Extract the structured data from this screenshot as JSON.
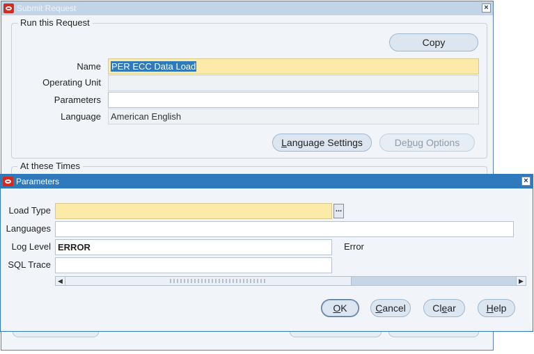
{
  "submit_window": {
    "title": "Submit Request",
    "run_group": {
      "legend": "Run this Request",
      "copy_button": "Copy",
      "name_label": "Name",
      "name_value": "PER ECC Data Load",
      "operating_unit_label": "Operating Unit",
      "operating_unit_value": "",
      "parameters_label": "Parameters",
      "parameters_value": "",
      "language_label": "Language",
      "language_value": "American English",
      "language_settings_button": {
        "pre": "",
        "ul": "L",
        "post": "anguage Settings"
      },
      "debug_options_button": {
        "pre": "De",
        "ul": "b",
        "post": "ug Options"
      }
    },
    "times_group": {
      "legend": "At these Times"
    }
  },
  "parameters_window": {
    "title": "Parameters",
    "load_type_label": "Load Type",
    "load_type_value": "",
    "lov_button": "...",
    "languages_label": "Languages",
    "languages_value": "",
    "log_level_label": "Log Level",
    "log_level_value": "ERROR",
    "log_level_description": "Error",
    "sql_trace_label": "SQL Trace",
    "sql_trace_value": "",
    "ok_button": {
      "pre": "",
      "ul": "O",
      "post": "K"
    },
    "cancel_button": {
      "pre": "",
      "ul": "C",
      "post": "ancel"
    },
    "clear_button": {
      "pre": "Cl",
      "ul": "e",
      "post": "ar"
    },
    "help_button": {
      "pre": "",
      "ul": "H",
      "post": "elp"
    }
  },
  "colors": {
    "active_titlebar": "#2f79bd",
    "inactive_titlebar": "#c3d4e6",
    "required_field": "#fceaa9",
    "window_bg": "#f1f4f8"
  }
}
